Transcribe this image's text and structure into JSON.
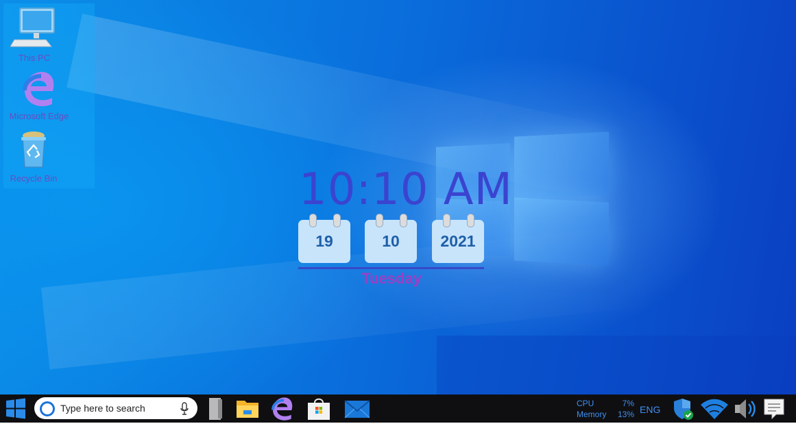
{
  "desktop_icons": [
    {
      "label": "This PC",
      "icon": "this-pc-icon"
    },
    {
      "label": "Microsoft Edge",
      "icon": "edge-icon"
    },
    {
      "label": "Recycle Bin",
      "icon": "recycle-bin-icon"
    }
  ],
  "clock_widget": {
    "time": "10:10 AM",
    "day": "19",
    "month": "10",
    "year": "2021",
    "weekday": "Tuesday"
  },
  "taskbar": {
    "start_icon": "windows-logo-icon",
    "search_placeholder": "Type here to search",
    "search_icon": "cortana-circle-icon",
    "mic_icon": "microphone-icon",
    "apps": [
      "task-view-icon",
      "file-explorer-icon",
      "edge-icon",
      "microsoft-store-icon",
      "mail-icon"
    ],
    "perf_monitor": {
      "cpu_label": "CPU",
      "cpu_value": "7%",
      "memory_label": "Memory",
      "memory_value": "13%"
    },
    "language": "ENG",
    "tray_icons": [
      "windows-security-icon",
      "wifi-icon",
      "volume-icon",
      "notifications-icon"
    ]
  },
  "colors": {
    "clock_text": "#3a44d0",
    "weekday_text": "#9a40c4",
    "perf_text": "#3f8ff0",
    "taskbar_bg": "#0f0f12"
  }
}
